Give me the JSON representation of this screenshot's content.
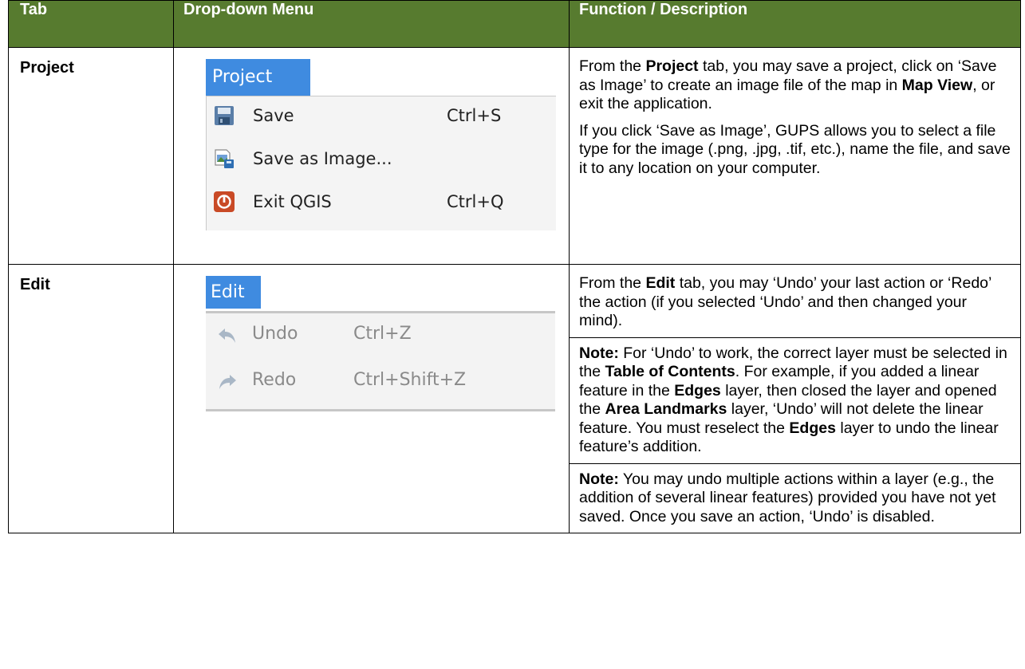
{
  "header": {
    "col1": "Tab",
    "col2": "Drop-down Menu",
    "col3": "Function / Description"
  },
  "rows": [
    {
      "tab": "Project",
      "menu": {
        "title": "Project",
        "items": [
          {
            "icon": "save-icon",
            "label": "Save",
            "shortcut": "Ctrl+S"
          },
          {
            "icon": "save-image-icon",
            "label": "Save as Image...",
            "shortcut": ""
          },
          {
            "icon": "exit-icon",
            "label": "Exit QGIS",
            "shortcut": "Ctrl+Q"
          }
        ]
      },
      "desc": {
        "p1_a": "From the ",
        "p1_b": "Project",
        "p1_c": " tab, you may save a project, click on ‘Save as Image’ to create an image file of the map in ",
        "p1_d": "Map View",
        "p1_e": ", or exit the application.",
        "p2": "If you click ‘Save as Image’, GUPS allows you to select a file type for the image (.png, .jpg, .tif, etc.), name the file, and save it to any location on your computer."
      }
    },
    {
      "tab": "Edit",
      "menu": {
        "title": "Edit",
        "items": [
          {
            "icon": "undo-icon",
            "label": "Undo",
            "shortcut": "Ctrl+Z"
          },
          {
            "icon": "redo-icon",
            "label": "Redo",
            "shortcut": "Ctrl+Shift+Z"
          }
        ]
      },
      "desc": {
        "p1_a": "From the ",
        "p1_b": "Edit",
        "p1_c": " tab, you may ‘Undo’ your last action or ‘Redo’ the action (if you selected ‘Undo’ and then changed your mind).",
        "n1_label": "Note:",
        "n1_a": "  For ‘Undo’ to work, the correct layer must be selected in the ",
        "n1_b": "Table of Contents",
        "n1_c": ". For example, if you added a linear feature in the ",
        "n1_d": "Edges",
        "n1_e": " layer, then closed the layer and opened the ",
        "n1_f": "Area Landmarks",
        "n1_g": " layer, ‘Undo’ will not delete the linear feature. You must reselect the ",
        "n1_h": "Edges",
        "n1_i": " layer to undo the linear feature’s addition.",
        "n2_label": "Note:",
        "n2_a": "  You may undo multiple actions within a layer (e.g., the addition of several linear features) provided you have not yet saved. Once you save an action, ‘Undo’ is disabled."
      }
    }
  ],
  "colors": {
    "header_bg": "#577b2f",
    "menu_tab_bg": "#3f8be0"
  }
}
